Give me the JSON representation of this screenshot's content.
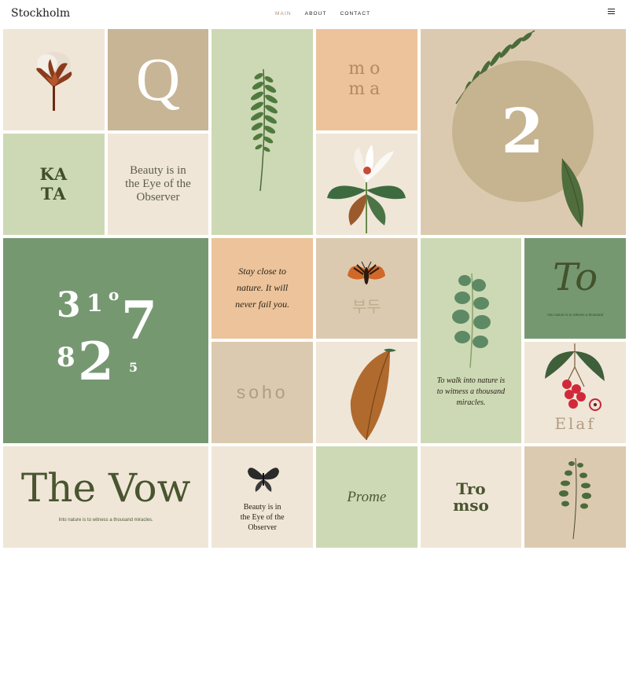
{
  "header": {
    "logo": "Stockholm",
    "nav": [
      {
        "label": "MAIN",
        "active": true
      },
      {
        "label": "ABOUT",
        "active": false
      },
      {
        "label": "CONTACT",
        "active": false
      }
    ],
    "menu_icon": "hamburger-icon"
  },
  "tiles": {
    "cotton": {
      "icon": "cotton-flower-illustration"
    },
    "q": {
      "text": "Q"
    },
    "fern": {
      "icon": "fern-illustration"
    },
    "moma": {
      "line1": "mo",
      "line2": "ma"
    },
    "two": {
      "text": "2"
    },
    "kata": {
      "line1": "KA",
      "line2": "TA"
    },
    "beauty": {
      "line1": "Beauty is in",
      "line2": "the Eye of the",
      "line3": "Observer"
    },
    "magnolia": {
      "icon": "magnolia-illustration"
    },
    "numbers": {
      "n1": "3",
      "n2": "1",
      "n3": "o",
      "n4": "8",
      "n5": "2",
      "n6": "7",
      "n7": "5"
    },
    "stay": {
      "line1": "Stay close to",
      "line2": "nature. It will",
      "line3": "never fail you."
    },
    "moth": {
      "icon": "moth-illustration",
      "text": "부두"
    },
    "eucalyptus": {
      "icon": "eucalyptus-illustration",
      "line1": "To walk into nature is",
      "line2": "to witness a thousand",
      "line3": "miracles."
    },
    "to": {
      "title": "To",
      "subtitle": "Into nature is to witness a thousand"
    },
    "soho": {
      "text": "soho"
    },
    "leaf": {
      "icon": "leaf-illustration"
    },
    "elaf": {
      "icon": "lychee-illustration",
      "text": "Elaf"
    },
    "vow": {
      "title": "The Vow",
      "subtitle": "Into nature is to witness a thousand miracles."
    },
    "butterfly": {
      "icon": "butterfly-illustration",
      "line1": "Beauty is in",
      "line2": "the Eye of the",
      "line3": "Observer"
    },
    "prome": {
      "text": "Prome"
    },
    "tromso": {
      "line1": "Tro",
      "line2": "mso"
    },
    "sprig": {
      "icon": "sprig-illustration"
    }
  },
  "colors": {
    "cream": "#efe6d8",
    "tan": "#c8b595",
    "sage": "#cdd9b5",
    "peach": "#ecc39b",
    "beige": "#dccab0",
    "green": "#769871",
    "nav_active": "#a99679"
  }
}
